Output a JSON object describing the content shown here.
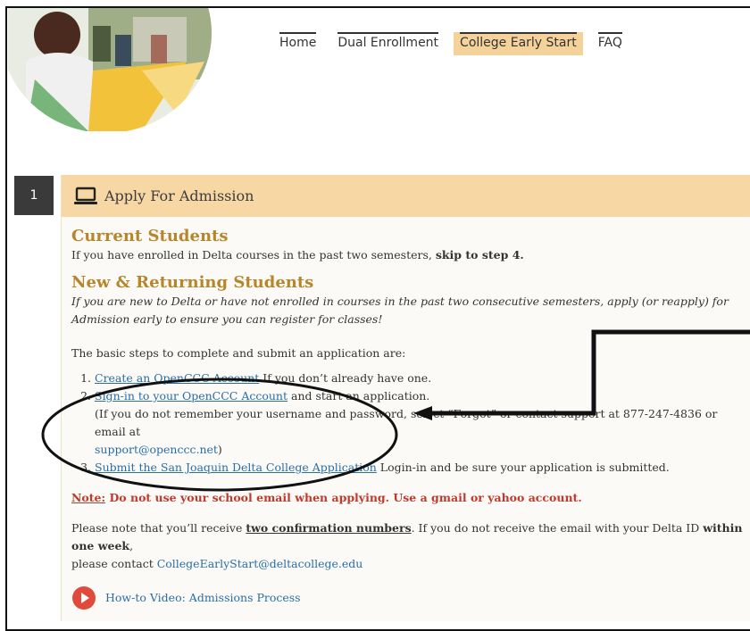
{
  "nav": {
    "items": [
      {
        "label": "Home",
        "active": false
      },
      {
        "label": "Dual Enrollment",
        "active": false
      },
      {
        "label": "College Early Start",
        "active": true
      },
      {
        "label": "FAQ",
        "active": false
      }
    ]
  },
  "step": {
    "number": "1",
    "icon": "laptop-icon",
    "title": "Apply For Admission"
  },
  "current": {
    "heading": "Current Students",
    "text": "If you have enrolled in Delta courses in the past two semesters,",
    "skip": "skip to step 4."
  },
  "new_returning": {
    "heading": "New & Returning Students",
    "intro": "If you are new to Delta or have not enrolled in courses in the past two consecutive semesters, apply (or reapply) for Admission early to ensure you can register for classes!",
    "steps_intro": "The basic steps to complete and submit an application are:",
    "step1_link": "Create an OpenCCC Account",
    "step1_text": " If you don’t already have one.",
    "step2_link": "Sign-in to your OpenCCC Account",
    "step2_text": " and start an application.",
    "step2_note": "(If you do not remember your username and password, select “Forgot” or contact support at 877-247-4836 or email at",
    "step2_email": "support@openccc.net",
    "step2_close": ")",
    "step3_link": "Submit the San Joaquin Delta College Application",
    "step3_text": " Login-in and be sure your application is submitted.",
    "note_label": "Note:",
    "note_text": " Do not use your school email when applying. Use a gmail or yahoo account.",
    "confirm_a": "Please note that you’ll receive ",
    "confirm_b": "two confirmation numbers",
    "confirm_c": ". If you do not receive the email with your Delta ID ",
    "confirm_d": "within one week",
    "confirm_e": ",",
    "contact_a": "please contact ",
    "contact_email": "CollegeEarlyStart@deltacollege.edu"
  },
  "video": {
    "icon": "play-icon",
    "label": "How-to Video: Admissions Process",
    "color": "#e04a3c"
  },
  "colors": {
    "accent": "#f7d7a4",
    "heading": "#b8862a",
    "link": "#2a6ea6",
    "warning": "#c0392b"
  }
}
